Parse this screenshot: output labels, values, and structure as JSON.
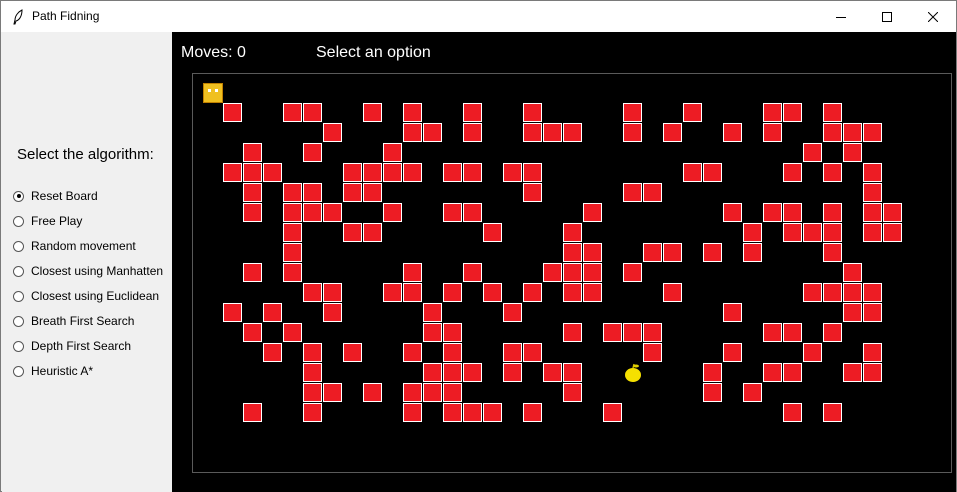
{
  "window": {
    "title": "Path Fidning"
  },
  "sidebar": {
    "title": "Select the algorithm:",
    "options": [
      {
        "label": "Reset Board",
        "selected": true
      },
      {
        "label": "Free Play",
        "selected": false
      },
      {
        "label": "Random movement",
        "selected": false
      },
      {
        "label": "Closest using Manhatten",
        "selected": false
      },
      {
        "label": "Closest using Euclidean",
        "selected": false
      },
      {
        "label": "Breath First Search",
        "selected": false
      },
      {
        "label": "Depth First Search",
        "selected": false
      },
      {
        "label": "Heuristic A*",
        "selected": false
      }
    ]
  },
  "game": {
    "moves": "Moves: 0",
    "status": "Select an option",
    "colors": {
      "wall": "#ed1c24",
      "wall_border": "#ffffff",
      "player": "#f0c020",
      "goal": "#f5e000",
      "background": "#000000"
    },
    "grid": {
      "cols": 38,
      "rows": 20
    },
    "player": {
      "col": 0,
      "row": 0
    },
    "goal": {
      "col": 21,
      "row": 14,
      "icon": "apple-icon"
    },
    "walls": [
      [
        1,
        1
      ],
      [
        4,
        1
      ],
      [
        5,
        1
      ],
      [
        8,
        1
      ],
      [
        10,
        1
      ],
      [
        13,
        1
      ],
      [
        16,
        1
      ],
      [
        21,
        1
      ],
      [
        24,
        1
      ],
      [
        28,
        1
      ],
      [
        29,
        1
      ],
      [
        31,
        1
      ],
      [
        6,
        2
      ],
      [
        10,
        2
      ],
      [
        11,
        2
      ],
      [
        13,
        2
      ],
      [
        16,
        2
      ],
      [
        17,
        2
      ],
      [
        18,
        2
      ],
      [
        21,
        2
      ],
      [
        23,
        2
      ],
      [
        26,
        2
      ],
      [
        28,
        2
      ],
      [
        31,
        2
      ],
      [
        32,
        2
      ],
      [
        33,
        2
      ],
      [
        2,
        3
      ],
      [
        5,
        3
      ],
      [
        9,
        3
      ],
      [
        30,
        3
      ],
      [
        32,
        3
      ],
      [
        1,
        4
      ],
      [
        2,
        4
      ],
      [
        3,
        4
      ],
      [
        7,
        4
      ],
      [
        8,
        4
      ],
      [
        9,
        4
      ],
      [
        10,
        4
      ],
      [
        12,
        4
      ],
      [
        13,
        4
      ],
      [
        15,
        4
      ],
      [
        16,
        4
      ],
      [
        24,
        4
      ],
      [
        25,
        4
      ],
      [
        29,
        4
      ],
      [
        31,
        4
      ],
      [
        33,
        4
      ],
      [
        2,
        5
      ],
      [
        4,
        5
      ],
      [
        5,
        5
      ],
      [
        7,
        5
      ],
      [
        8,
        5
      ],
      [
        16,
        5
      ],
      [
        21,
        5
      ],
      [
        22,
        5
      ],
      [
        33,
        5
      ],
      [
        2,
        6
      ],
      [
        4,
        6
      ],
      [
        5,
        6
      ],
      [
        6,
        6
      ],
      [
        9,
        6
      ],
      [
        12,
        6
      ],
      [
        13,
        6
      ],
      [
        19,
        6
      ],
      [
        26,
        6
      ],
      [
        28,
        6
      ],
      [
        29,
        6
      ],
      [
        31,
        6
      ],
      [
        33,
        6
      ],
      [
        34,
        6
      ],
      [
        4,
        7
      ],
      [
        7,
        7
      ],
      [
        8,
        7
      ],
      [
        14,
        7
      ],
      [
        18,
        7
      ],
      [
        27,
        7
      ],
      [
        29,
        7
      ],
      [
        30,
        7
      ],
      [
        31,
        7
      ],
      [
        33,
        7
      ],
      [
        34,
        7
      ],
      [
        4,
        8
      ],
      [
        18,
        8
      ],
      [
        19,
        8
      ],
      [
        22,
        8
      ],
      [
        23,
        8
      ],
      [
        25,
        8
      ],
      [
        27,
        8
      ],
      [
        31,
        8
      ],
      [
        2,
        9
      ],
      [
        4,
        9
      ],
      [
        10,
        9
      ],
      [
        13,
        9
      ],
      [
        17,
        9
      ],
      [
        18,
        9
      ],
      [
        19,
        9
      ],
      [
        21,
        9
      ],
      [
        32,
        9
      ],
      [
        5,
        10
      ],
      [
        6,
        10
      ],
      [
        9,
        10
      ],
      [
        10,
        10
      ],
      [
        12,
        10
      ],
      [
        14,
        10
      ],
      [
        16,
        10
      ],
      [
        18,
        10
      ],
      [
        19,
        10
      ],
      [
        23,
        10
      ],
      [
        30,
        10
      ],
      [
        31,
        10
      ],
      [
        32,
        10
      ],
      [
        33,
        10
      ],
      [
        1,
        11
      ],
      [
        3,
        11
      ],
      [
        6,
        11
      ],
      [
        11,
        11
      ],
      [
        15,
        11
      ],
      [
        26,
        11
      ],
      [
        32,
        11
      ],
      [
        33,
        11
      ],
      [
        2,
        12
      ],
      [
        4,
        12
      ],
      [
        11,
        12
      ],
      [
        12,
        12
      ],
      [
        18,
        12
      ],
      [
        20,
        12
      ],
      [
        21,
        12
      ],
      [
        22,
        12
      ],
      [
        28,
        12
      ],
      [
        29,
        12
      ],
      [
        31,
        12
      ],
      [
        3,
        13
      ],
      [
        5,
        13
      ],
      [
        7,
        13
      ],
      [
        10,
        13
      ],
      [
        12,
        13
      ],
      [
        15,
        13
      ],
      [
        16,
        13
      ],
      [
        22,
        13
      ],
      [
        26,
        13
      ],
      [
        30,
        13
      ],
      [
        33,
        13
      ],
      [
        5,
        14
      ],
      [
        11,
        14
      ],
      [
        12,
        14
      ],
      [
        13,
        14
      ],
      [
        15,
        14
      ],
      [
        17,
        14
      ],
      [
        18,
        14
      ],
      [
        25,
        14
      ],
      [
        28,
        14
      ],
      [
        29,
        14
      ],
      [
        32,
        14
      ],
      [
        33,
        14
      ],
      [
        5,
        15
      ],
      [
        6,
        15
      ],
      [
        8,
        15
      ],
      [
        10,
        15
      ],
      [
        11,
        15
      ],
      [
        12,
        15
      ],
      [
        18,
        15
      ],
      [
        25,
        15
      ],
      [
        27,
        15
      ],
      [
        2,
        16
      ],
      [
        5,
        16
      ],
      [
        10,
        16
      ],
      [
        12,
        16
      ],
      [
        13,
        16
      ],
      [
        14,
        16
      ],
      [
        16,
        16
      ],
      [
        20,
        16
      ],
      [
        29,
        16
      ],
      [
        31,
        16
      ]
    ]
  }
}
